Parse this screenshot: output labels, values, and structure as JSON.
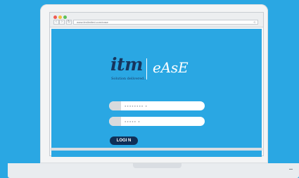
{
  "browser": {
    "url": "www.itmlimited.com/ease"
  },
  "brand": {
    "logo_primary": "itm",
    "tagline": "Solution delivered...",
    "logo_secondary": "eAsE"
  },
  "login_form": {
    "username_value": "●●●●●●●●  ●",
    "password_value": "●●●●●  ●",
    "login_label": "LOGI N"
  },
  "colors": {
    "background": "#2aa7e3",
    "brand_navy": "#16355d",
    "button_navy": "#0f2f57"
  }
}
